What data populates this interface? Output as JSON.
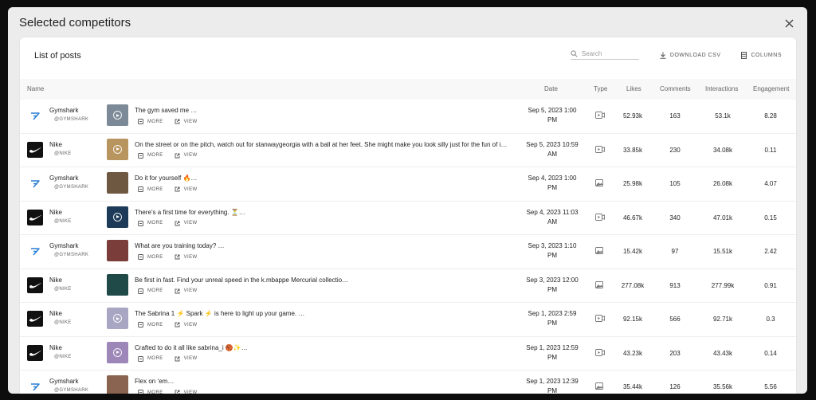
{
  "modal": {
    "title": "Selected competitors"
  },
  "card": {
    "title": "List of posts"
  },
  "toolbar": {
    "search_placeholder": "Search",
    "download_label": "DOWNLOAD CSV",
    "columns_label": "COLUMNS"
  },
  "columns": {
    "name": "Name",
    "date": "Date",
    "type": "Type",
    "likes": "Likes",
    "comments": "Comments",
    "interactions": "Interactions",
    "engagement": "Engagement"
  },
  "actions": {
    "more": "MORE",
    "view": "VIEW"
  },
  "rows": [
    {
      "brand": "gymshark",
      "name": "Gymshark",
      "handle": "@GYMSHARK",
      "caption": "The gym saved me …",
      "date1": "Sep 5, 2023 1:00",
      "date2": "PM",
      "type": "video",
      "likes": "52.93k",
      "comments": "163",
      "interactions": "53.1k",
      "engagement": "8.28",
      "thumb_color": "#7b8a96",
      "thumb_play": true
    },
    {
      "brand": "nike",
      "name": "Nike",
      "handle": "@NIKE",
      "caption": "On the street or on the pitch, watch out for stanwaygeorgia with a ball at her feet. She might make you look silly just for the fun of i…",
      "date1": "Sep 5, 2023 10:59",
      "date2": "AM",
      "type": "video",
      "likes": "33.85k",
      "comments": "230",
      "interactions": "34.08k",
      "engagement": "0.11",
      "thumb_color": "#b8945e",
      "thumb_play": true
    },
    {
      "brand": "gymshark",
      "name": "Gymshark",
      "handle": "@GYMSHARK",
      "caption": "Do it for yourself 🔥…",
      "date1": "Sep 4, 2023 1:00",
      "date2": "PM",
      "type": "image",
      "likes": "25.98k",
      "comments": "105",
      "interactions": "26.08k",
      "engagement": "4.07",
      "thumb_color": "#6e5842",
      "thumb_play": false
    },
    {
      "brand": "nike",
      "name": "Nike",
      "handle": "@NIKE",
      "caption": "There’s a first time for everything. ⏳…",
      "date1": "Sep 4, 2023 11:03",
      "date2": "AM",
      "type": "video",
      "likes": "46.67k",
      "comments": "340",
      "interactions": "47.01k",
      "engagement": "0.15",
      "thumb_color": "#1d3b58",
      "thumb_play": true
    },
    {
      "brand": "gymshark",
      "name": "Gymshark",
      "handle": "@GYMSHARK",
      "caption": "What are you training today? …",
      "date1": "Sep 3, 2023 1:10",
      "date2": "PM",
      "type": "image",
      "likes": "15.42k",
      "comments": "97",
      "interactions": "15.51k",
      "engagement": "2.42",
      "thumb_color": "#7a3d3a",
      "thumb_play": false
    },
    {
      "brand": "nike",
      "name": "Nike",
      "handle": "@NIKE",
      "caption": "Be first in fast. Find your unreal speed in the k.mbappe Mercurial collectio…",
      "date1": "Sep 3, 2023 12:00",
      "date2": "PM",
      "type": "image",
      "likes": "277.08k",
      "comments": "913",
      "interactions": "277.99k",
      "engagement": "0.91",
      "thumb_color": "#1f4a48",
      "thumb_play": false
    },
    {
      "brand": "nike",
      "name": "Nike",
      "handle": "@NIKE",
      "caption": "The Sabrina 1 ⚡ Spark ⚡ is here to light up your game. …",
      "date1": "Sep 1, 2023 2:59",
      "date2": "PM",
      "type": "video",
      "likes": "92.15k",
      "comments": "566",
      "interactions": "92.71k",
      "engagement": "0.3",
      "thumb_color": "#a8a6c2",
      "thumb_play": true
    },
    {
      "brand": "nike",
      "name": "Nike",
      "handle": "@NIKE",
      "caption": "Crafted to do it all like sabrina_i 🏀✨…",
      "date1": "Sep 1, 2023 12:59",
      "date2": "PM",
      "type": "video",
      "likes": "43.23k",
      "comments": "203",
      "interactions": "43.43k",
      "engagement": "0.14",
      "thumb_color": "#9c87b8",
      "thumb_play": true
    },
    {
      "brand": "gymshark",
      "name": "Gymshark",
      "handle": "@GYMSHARK",
      "caption": "Flex on ‘em…",
      "date1": "Sep 1, 2023 12:39",
      "date2": "PM",
      "type": "image",
      "likes": "35.44k",
      "comments": "126",
      "interactions": "35.56k",
      "engagement": "5.56",
      "thumb_color": "#8a6450",
      "thumb_play": false
    }
  ]
}
